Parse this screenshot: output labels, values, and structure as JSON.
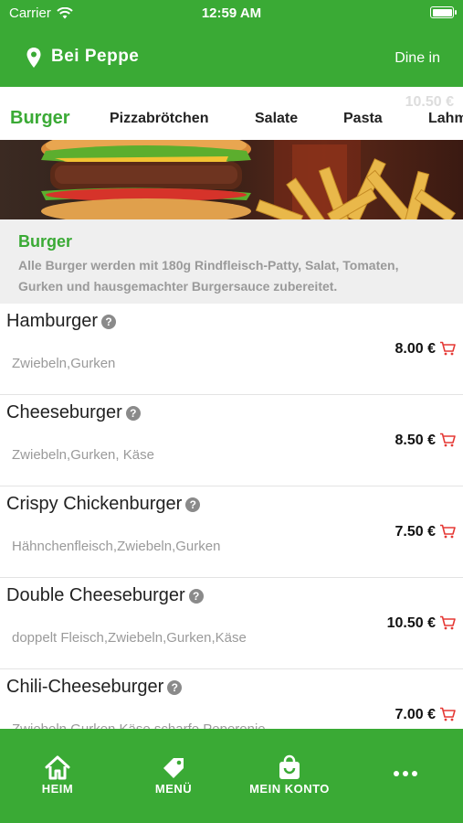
{
  "status_bar": {
    "carrier": "Carrier",
    "time": "12:59 AM"
  },
  "header": {
    "restaurant": "Bei Peppe",
    "mode": "Dine in"
  },
  "tabs": [
    {
      "label": "Burger",
      "active": true
    },
    {
      "label": "Pizzabrötchen"
    },
    {
      "label": "Salate"
    },
    {
      "label": "Pasta"
    },
    {
      "label": "Lahm"
    }
  ],
  "tabs_ghost": "10.50 €",
  "category": {
    "title": "Burger",
    "description": "Alle Burger werden mit 180g Rindfleisch-Patty, Salat, Tomaten, Gurken und hausgemachter Burgersauce zubereitet."
  },
  "items": [
    {
      "name": "Hamburger",
      "desc": "Zwiebeln,Gurken",
      "price": "8.00 €"
    },
    {
      "name": "Cheeseburger",
      "desc": "Zwiebeln,Gurken, Käse",
      "price": "8.50 €"
    },
    {
      "name": "Crispy Chickenburger",
      "desc": "Hähnchenfleisch,Zwiebeln,Gurken",
      "price": "7.50 €"
    },
    {
      "name": "Double Cheeseburger",
      "desc": "doppelt Fleisch,Zwiebeln,Gurken,Käse",
      "price": "10.50 €"
    },
    {
      "name": "Chili-Cheeseburger",
      "desc": "Zwiebeln,Gurken,Käse,scharfe Peperonie",
      "price": "7.00 €"
    }
  ],
  "help_glyph": "?",
  "nav": {
    "home": "HEIM",
    "menu": "MENÜ",
    "account": "MEIN KONTO"
  },
  "colors": {
    "brand_green": "#3aaa35",
    "cart_red": "#e53935"
  }
}
